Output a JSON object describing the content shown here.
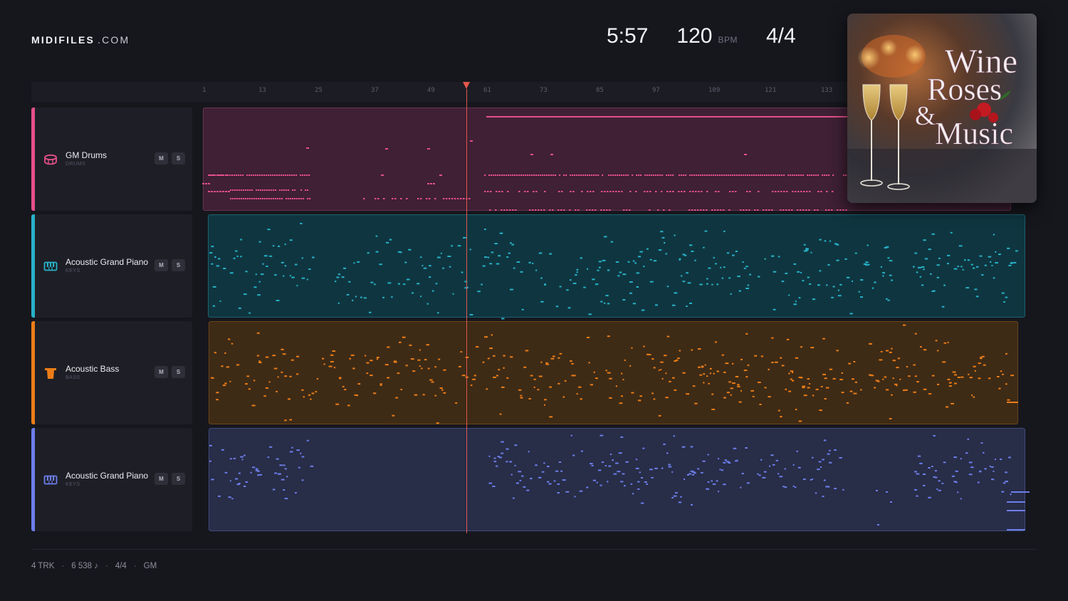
{
  "brand": {
    "name": "MIDIFILES",
    "domain": ".COM"
  },
  "stats": {
    "time": "5:57",
    "tempo": "120",
    "tempo_unit": "BPM",
    "signature": "4/4"
  },
  "ruler": {
    "ticks": [
      "1",
      "13",
      "25",
      "37",
      "49",
      "61",
      "73",
      "85",
      "97",
      "109",
      "121",
      "133"
    ]
  },
  "tracks": [
    {
      "name": "GM Drums",
      "category": "DRUMS",
      "color": "#e5508a",
      "icon": "drum-icon",
      "mute": "M",
      "solo": "S"
    },
    {
      "name": "Acoustic Grand Piano",
      "category": "KEYS",
      "color": "#27b1c8",
      "icon": "piano-icon",
      "mute": "M",
      "solo": "S"
    },
    {
      "name": "Acoustic Bass",
      "category": "BASS",
      "color": "#ec7d18",
      "icon": "bass-icon",
      "mute": "M",
      "solo": "S"
    },
    {
      "name": "Acoustic Grand Piano",
      "category": "KEYS",
      "color": "#6c7eea",
      "icon": "piano-icon",
      "mute": "M",
      "solo": "S"
    }
  ],
  "playhead": {
    "bar": 61
  },
  "cover": {
    "title_lines": [
      "Wine",
      "Roses",
      "&",
      "Music"
    ],
    "icon": "champagne-glasses-icon"
  },
  "footer": {
    "tracks": "4 TRK",
    "notes": "6 538 ♪",
    "signature": "4/4",
    "standard": "GM"
  },
  "colors": {
    "background": "#16171d",
    "panel": "#1e1f26",
    "playhead": "#e2574c"
  }
}
